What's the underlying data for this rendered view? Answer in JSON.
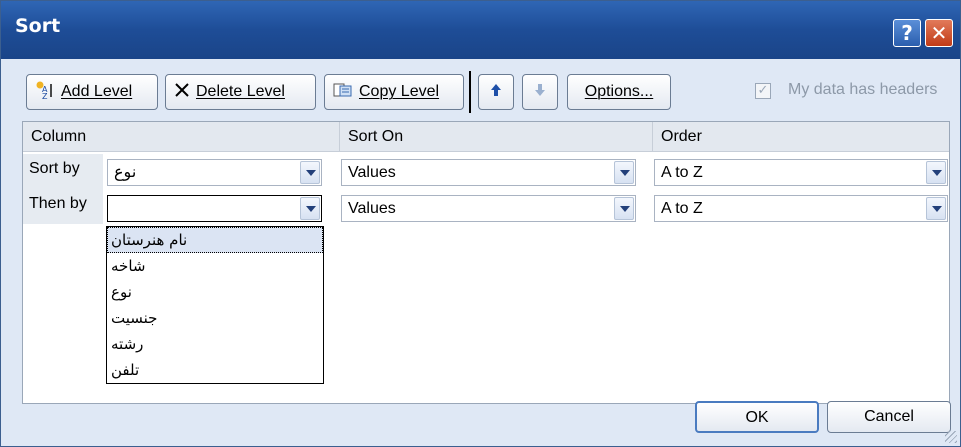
{
  "window": {
    "title": "Sort",
    "help_label": "?",
    "close_label": "✕"
  },
  "toolbar": {
    "add_level": "Add Level",
    "delete_level": "Delete Level",
    "copy_level": "Copy Level",
    "options": "Options...",
    "headers_checkbox_label": "My data has headers",
    "headers_checked": true
  },
  "columns": {
    "column": "Column",
    "sort_on": "Sort On",
    "order": "Order"
  },
  "rows": [
    {
      "label": "Sort by",
      "column": "نوع",
      "sort_on": "Values",
      "order": "A to Z"
    },
    {
      "label": "Then by",
      "column": "",
      "sort_on": "Values",
      "order": "A to Z"
    }
  ],
  "dropdown": {
    "options": [
      "نام هنرستان",
      "شاخه",
      "نوع",
      "جنسیت",
      "رشته",
      "تلفن"
    ],
    "highlighted_index": 0
  },
  "footer": {
    "ok": "OK",
    "cancel": "Cancel"
  },
  "colors": {
    "titlebar": "#1e4d97",
    "dialog_bg": "#dfe8f5",
    "close": "#c13b17"
  }
}
